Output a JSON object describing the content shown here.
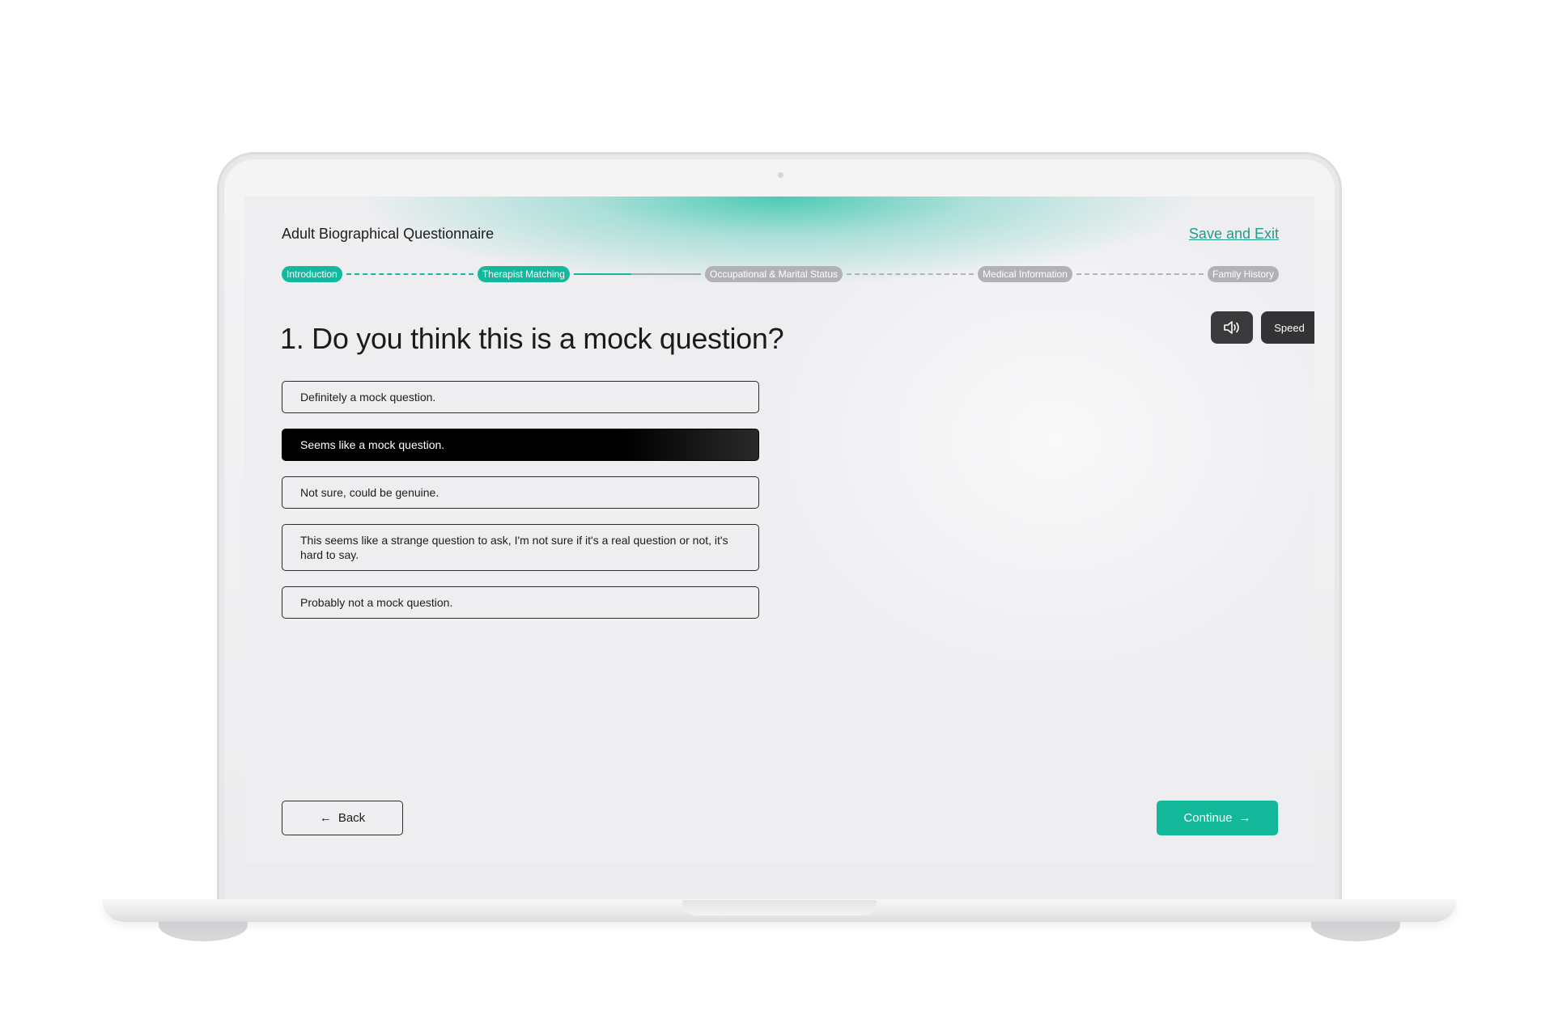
{
  "header": {
    "title": "Adult Biographical Questionnaire",
    "save_exit": "Save and Exit"
  },
  "stepper": {
    "steps": [
      {
        "label": "Introduction",
        "state": "done"
      },
      {
        "label": "Therapist Matching",
        "state": "done"
      },
      {
        "label": "Occupational & Marital Status",
        "state": "todo"
      },
      {
        "label": "Medical Information",
        "state": "todo"
      },
      {
        "label": "Family History",
        "state": "todo"
      }
    ]
  },
  "audio": {
    "icon": "speaker-icon",
    "speed_label": "Speed"
  },
  "question": {
    "text": "1. Do you think this is a mock question?",
    "options": [
      "Definitely a mock question.",
      "Seems like a mock question.",
      "Not sure, could be genuine.",
      "This seems like a strange question to ask, I'm not sure if it's a real question or not, it's hard to say.",
      "Probably not a mock question."
    ],
    "selected_index": 1
  },
  "nav": {
    "back_label": "Back",
    "continue_label": "Continue",
    "back_icon": "arrow-left-icon",
    "continue_icon": "arrow-right-icon"
  },
  "colors": {
    "accent": "#13b89b",
    "selected": "#000000",
    "inactive_step": "#b2b2b6"
  }
}
